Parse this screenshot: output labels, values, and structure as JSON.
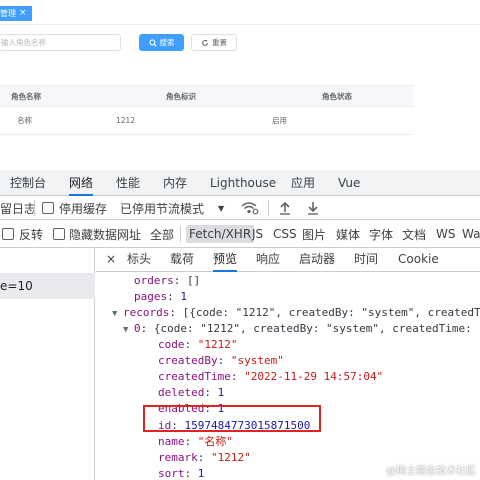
{
  "app": {
    "tab_chip": {
      "label": "管理",
      "close": "×"
    },
    "search": {
      "placeholder": "输入角色名称",
      "value": ""
    },
    "buttons": {
      "search": "搜索",
      "reset": "重置"
    },
    "table": {
      "headers": [
        "角色名称",
        "角色标识",
        "角色状态"
      ],
      "rows": [
        {
          "name": "名称",
          "key": "1212",
          "status": "启用"
        }
      ]
    },
    "colors": {
      "primary": "#409eff"
    }
  },
  "devtools": {
    "tabs": [
      "控制台",
      "网络",
      "性能",
      "内存",
      "Lighthouse",
      "应用",
      "Vue"
    ],
    "active_tab": "网络",
    "toolbar": {
      "preserve_log": "留日志",
      "disable_cache": "停用缓存",
      "throttle": "已停用节流模式"
    },
    "filter": {
      "invert": "反转",
      "hide_data_urls": "隐藏数据网址",
      "types": [
        "全部",
        "Fetch/XHR",
        "JS",
        "CSS",
        "图片",
        "媒体",
        "字体",
        "文档",
        "WS",
        "Wa"
      ],
      "active_type": "Fetch/XHR"
    },
    "request_row": "e=10",
    "detail_tabs": {
      "close": "×",
      "items": [
        "标头",
        "载荷",
        "预览",
        "响应",
        "启动器",
        "时间",
        "Cookie"
      ],
      "active": "预览"
    },
    "preview": {
      "orders": "[]",
      "pages": "1",
      "records_summary": "[{code: \"1212\", createdBy: \"system\", createdT",
      "item0_summary": "{code: \"1212\", createdBy: \"system\", createdTime:",
      "code": "\"1212\"",
      "createdBy": "\"system\"",
      "createdTime": "\"2022-11-29 14:57:04\"",
      "deleted": "1",
      "enabled": "1",
      "id": "1597484773015871500",
      "name": "\"名称\"",
      "remark": "\"1212\"",
      "sort": "1"
    },
    "colors": {
      "active_tab_underline": "#1a73e8",
      "highlight_box": "#e02424"
    }
  },
  "watermark": "@稀土掘金技术社区"
}
